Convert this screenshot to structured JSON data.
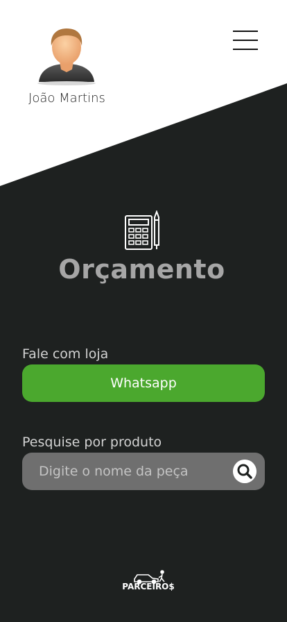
{
  "user": {
    "name": "João Martins",
    "avatar_icon": "user-avatar-icon"
  },
  "header": {
    "menu_icon": "hamburger-menu-icon"
  },
  "page": {
    "title": "Orçamento",
    "icon": "calculator-pencil-icon"
  },
  "contact": {
    "label": "Fale com loja",
    "button_label": "Whatsapp",
    "button_color": "#4ba82e"
  },
  "search": {
    "label": "Pesquise por produto",
    "placeholder": "Digite o nome da peça",
    "value": "",
    "icon": "search-icon"
  },
  "brand": {
    "logo_text": "PARCEIRO$",
    "logo_icon": "car-logo-icon"
  },
  "colors": {
    "background_dark": "#1e2120",
    "background_light": "#ffffff",
    "title": "#a6a6a6",
    "search_field": "#6f6f6f"
  }
}
